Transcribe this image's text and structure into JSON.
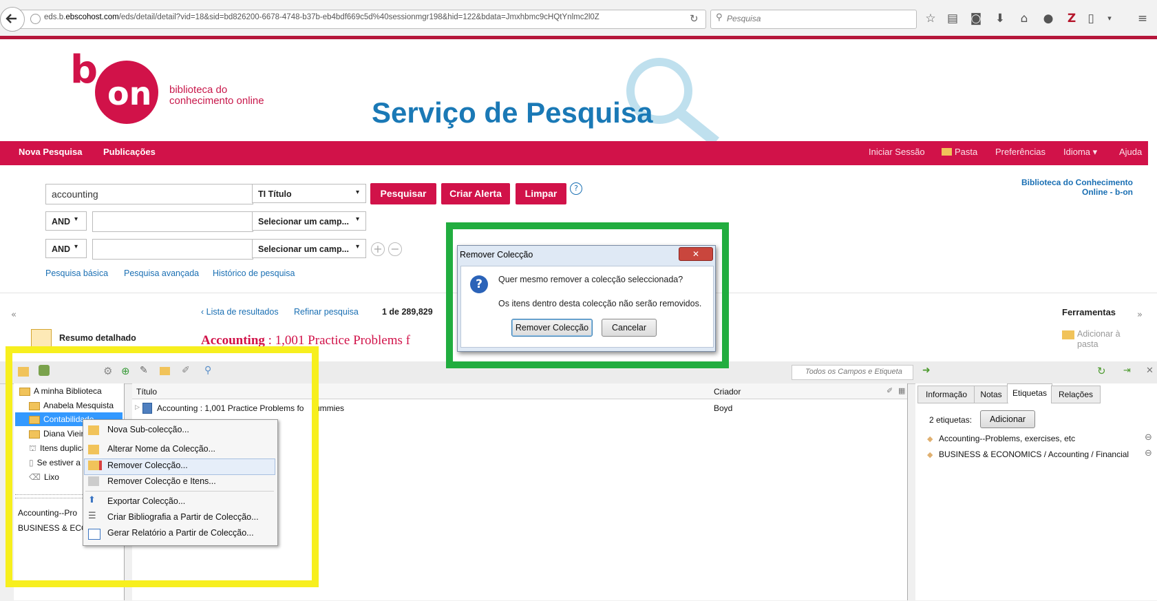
{
  "browser": {
    "url_prefix": "eds.b.",
    "url_domain": "ebscohost.com",
    "url_rest": "/eds/detail/detail?vid=18&sid=bd826200-6678-4748-b37b-eb4bdf669c5d%40sessionmgr198&hid=122&bdata=Jmxhbmc9cHQtYnlmc2l0Z",
    "search_placeholder": "Pesquisa"
  },
  "header": {
    "logo_text": "on",
    "logo_letter": "b",
    "tagline_1": "biblioteca do",
    "tagline_2": "conhecimento online",
    "title": "Serviço de Pesquisa"
  },
  "nav": {
    "left": [
      "Nova Pesquisa",
      "Publicações"
    ],
    "right": [
      "Iniciar Sessão",
      "Pasta",
      "Preferências",
      "Idioma ▾",
      "Ajuda"
    ]
  },
  "search": {
    "query": "accounting",
    "field1": "TI Título",
    "field2": "Selecionar um camp...",
    "field3": "Selecionar um camp...",
    "op2": "AND",
    "op3": "AND",
    "btn_search": "Pesquisar",
    "btn_alert": "Criar Alerta",
    "btn_clear": "Limpar",
    "links": [
      "Pesquisa básica",
      "Pesquisa avançada",
      "Histórico de pesquisa"
    ],
    "library_1": "Biblioteca do Conhecimento",
    "library_2": "Online - b-on"
  },
  "result": {
    "back": "Lista de resultados",
    "refine": "Refinar pesquisa",
    "pager": "1 de 289,829",
    "detail": "Resumo detalhado",
    "heading_start": "Accounting",
    "heading_rest": " : 1,001 Practice Problems f",
    "tools": "Ferramentas",
    "add_1": "Adicionar à",
    "add_2": "pasta"
  },
  "dialog": {
    "title": "Remover Colecção",
    "question": "Quer mesmo remover a colecção seleccionada?",
    "note": "Os itens dentro desta colecção não serão removidos.",
    "ok": "Remover Colecção",
    "cancel": "Cancelar"
  },
  "zotero": {
    "filter_placeholder": "Todos os Campos e Etiqueta",
    "tree": [
      "A minha Biblioteca",
      "Anabela Mesquista",
      "Contabilidade",
      "Diana Vieira",
      "Itens duplicados",
      "Se estiver a",
      "Lixo"
    ],
    "tags_left": [
      "Accounting--Pro",
      "BUSINESS & ECO"
    ],
    "col_title": "Título",
    "col_creator": "Criador",
    "item_title": "Accounting : 1,001 Practice Problems fo",
    "item_title_tail": "ummies",
    "item_creator": "Boyd",
    "right_tabs": [
      "Informação",
      "Notas",
      "Etiquetas",
      "Relações"
    ],
    "tags_count": "2 etiquetas:",
    "add": "Adicionar",
    "tags": [
      "Accounting--Problems, exercises, etc",
      "BUSINESS & ECONOMICS / Accounting / Financial"
    ]
  },
  "menu": {
    "items": [
      "Nova Sub-colecção...",
      "Alterar Nome da Colecção...",
      "Remover Colecção...",
      "Remover Colecção e Itens...",
      "Exportar Colecção...",
      "Criar Bibliografia a Partir de Colecção...",
      "Gerar Relatório a Partir de Colecção..."
    ]
  },
  "colors": {
    "brand_red": "#d11249",
    "title_blue": "#1a79b6",
    "highlight_green": "#21ad3f",
    "highlight_yellow": "#f7ef1e"
  }
}
